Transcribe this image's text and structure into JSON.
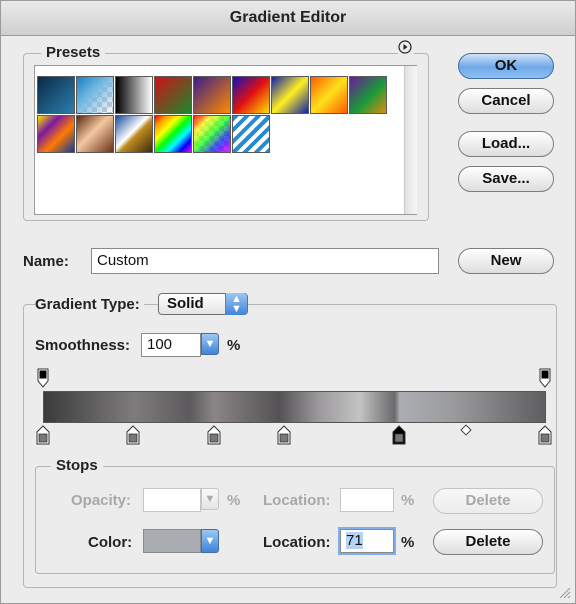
{
  "window": {
    "title": "Gradient Editor"
  },
  "presets": {
    "legend": "Presets",
    "menu_icon": "circle-arrow-right-icon",
    "swatches": [
      {
        "name": "foreground-to-background",
        "bg": "linear-gradient(135deg,#0a2a44,#2b7fb0)"
      },
      {
        "name": "foreground-to-transparent",
        "bg": "linear-gradient(135deg,#1a7fc0 0%,#6fb6e0 40%,transparent 100%),repeating-conic-gradient(#ccc 0% 25%,#fff 0% 50%) 0 0/10px 10px"
      },
      {
        "name": "black-white",
        "bg": "linear-gradient(90deg,#000,#fff)"
      },
      {
        "name": "red-green",
        "bg": "linear-gradient(135deg,#d0101a,#1a8a2a)"
      },
      {
        "name": "violet-orange",
        "bg": "linear-gradient(135deg,#3a1e8a,#ff8a00)"
      },
      {
        "name": "blue-red-yellow",
        "bg": "linear-gradient(135deg,#1010c0,#e01010,#ffe000)"
      },
      {
        "name": "blue-yellow-blue",
        "bg": "linear-gradient(135deg,#1020b0,#ffee20 50%,#1020b0)"
      },
      {
        "name": "orange-yellow-orange",
        "bg": "linear-gradient(135deg,#ff5a00,#ffe21a 50%,#ff5a00)"
      },
      {
        "name": "violet-green-orange",
        "bg": "linear-gradient(135deg,#6a1a9a,#1a9a3a 55%,#e08a10)"
      },
      {
        "name": "yellow-violet-orange-blue",
        "bg": "linear-gradient(135deg,#ffe000,#7a1aa0 30%,#ff7a00 60%,#0a3aa0)"
      },
      {
        "name": "copper",
        "bg": "linear-gradient(135deg,#5a2a10,#f2c8a0 45%,#6a3018)"
      },
      {
        "name": "chrome",
        "bg": "linear-gradient(135deg,#1a4a9a,#ffffff 45%,#c08a20 55%,#3a2a10)"
      },
      {
        "name": "spectrum",
        "bg": "linear-gradient(135deg,red,orange,yellow,lime,cyan,blue,magenta)"
      },
      {
        "name": "transparent-rainbow",
        "bg": "linear-gradient(135deg,rgba(255,0,0,.9),rgba(255,255,0,.7),rgba(0,255,0,.7),rgba(0,0,255,.7),rgba(255,0,255,.9)),repeating-conic-gradient(#ccc 0% 25%,#fff 0% 50%) 0 0/10px 10px"
      },
      {
        "name": "transparent-stripes",
        "bg": "repeating-linear-gradient(135deg,#2a8ad0 0 4px,#ffffff 4px 8px)"
      }
    ]
  },
  "buttons": {
    "ok": "OK",
    "cancel": "Cancel",
    "load": "Load...",
    "save": "Save...",
    "new": "New"
  },
  "name": {
    "label": "Name:",
    "value": "Custom"
  },
  "gradient_type": {
    "label": "Gradient Type:",
    "value": "Solid"
  },
  "smoothness": {
    "label": "Smoothness:",
    "value": "100",
    "unit": "%"
  },
  "gradient_bar": {
    "css": "linear-gradient(90deg,#3b3b3b 0%,#7f7c7e 18%,#5c5a5c 29%,#8a8587 34%,#545254 47%,#9c9a9c 55%,#c3c3c3 63%,#6b696b 70%,#aaadb2 71%,#9a9a9c 82%,#5e5d5f 100%)",
    "opacity_stops": [
      0,
      100
    ],
    "color_stops": [
      0,
      18,
      34,
      48,
      71,
      100
    ],
    "selected_color_stop": 71,
    "midpoint": 84
  },
  "stops": {
    "legend": "Stops",
    "opacity_label": "Opacity:",
    "opacity_unit": "%",
    "location_label": "Location:",
    "location_unit": "%",
    "delete_label": "Delete",
    "color_label": "Color:",
    "color_value": "#a9acb1",
    "color_location_value": "71"
  }
}
